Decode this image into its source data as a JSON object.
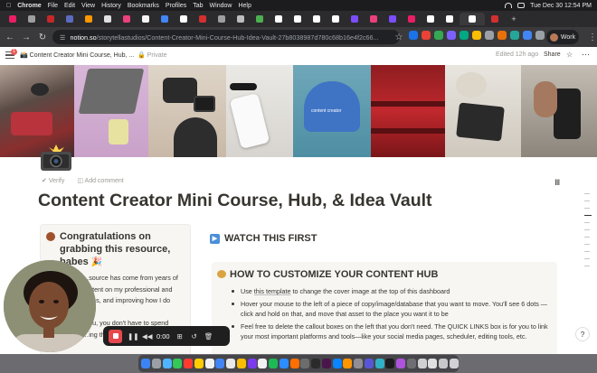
{
  "menubar": {
    "apple": "",
    "items": [
      "Chrome",
      "File",
      "Edit",
      "View",
      "History",
      "Bookmarks",
      "Profiles",
      "Tab",
      "Window",
      "Help"
    ],
    "clock": "Tue Dec 30  12:54 PM"
  },
  "browser": {
    "url_host": "notion.so",
    "url_rest": "/storytellastudios/Content-Creator-Mini-Course-Hub-Idea-Vault-27b8038987d780c68b16e4f2c66...",
    "profile_label": "Work"
  },
  "notion": {
    "breadcrumb": "Content Creator Mini Course, Hub, ...",
    "privacy": "Private",
    "edited": "Edited 12h ago",
    "share": "Share",
    "notification_count": "1",
    "verify": "Verify",
    "add_comment": "Add comment",
    "title": "Content Creator Mini Course, Hub, & Idea Vault",
    "left_callout": {
      "heading": "Congratulations on grabbing this resource, babes",
      "body_lines": [
        "…source has come from years of",
        "…ntent on my professional and",
        "…ges, and improving how I do",
        "",
        "…ou, you don't have to spend",
        "…ing this and"
      ]
    },
    "watch_heading": "WATCH THIS FIRST",
    "customize": {
      "heading": "HOW TO CUSTOMIZE YOUR CONTENT HUB",
      "items": [
        {
          "pre": "Use ",
          "link": "this template",
          "post": " to change the cover image at the top of this dashboard"
        },
        {
          "pre": "Hover your mouse to the left of a piece of copy/image/database that you want to move. You'll see 6 dots — click and hold on that, and move that asset to the place you want it to be",
          "link": "",
          "post": ""
        },
        {
          "pre": "Feel free to delete the callout boxes on the left that you don't need. The QUICK LINKS box is for you to link your most important platforms and tools—like your social media pages, scheduler, editing tools, etc.",
          "link": "",
          "post": ""
        }
      ]
    },
    "help_label": "?"
  },
  "recorder": {
    "time": "0:00"
  },
  "colors": {
    "page_bg": "#ffffff",
    "text": "#37352f",
    "muted": "#9b9a97",
    "callout_bg": "#f7f6f3",
    "record_red": "#e5484d"
  },
  "icons": {
    "cover_camera": "camera-flash-icon",
    "callout_emoji": "woman-emoji-icon",
    "customize_emoji": "palette-icon",
    "watch_emoji": "play-button-icon"
  }
}
